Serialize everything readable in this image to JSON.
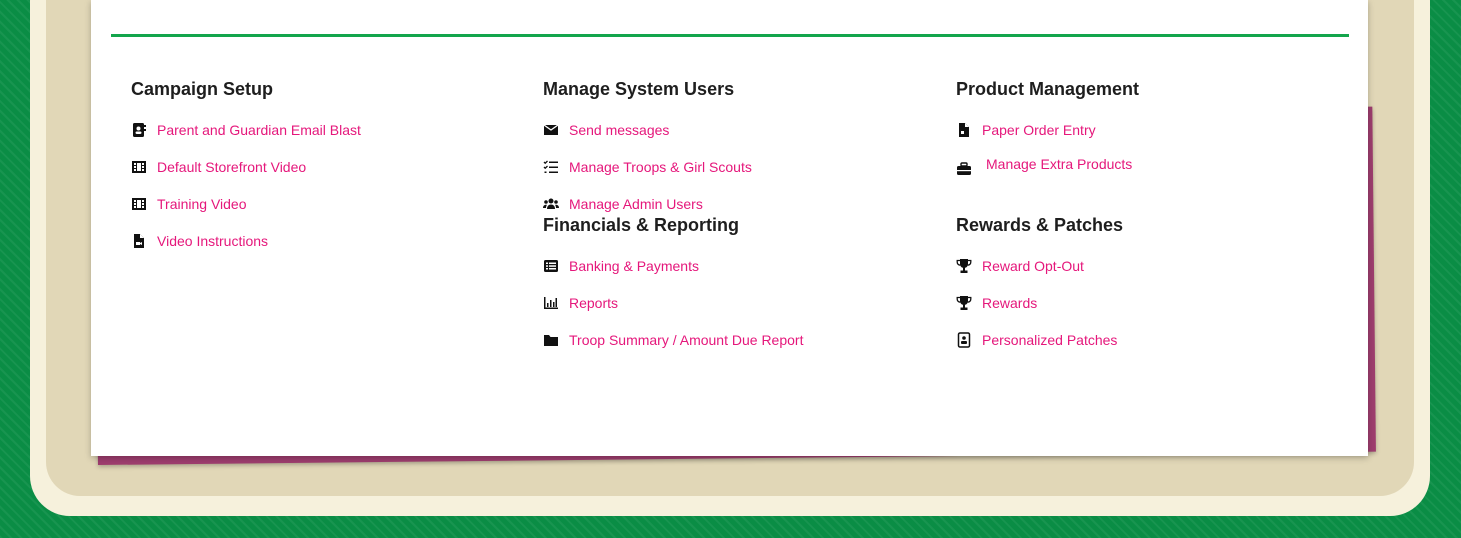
{
  "colors": {
    "accent": "#e5177b",
    "rule": "#13a54c",
    "background": "#0a8d45",
    "sheet": "#9e3d6e"
  },
  "columns": [
    {
      "sections": [
        {
          "title": "Campaign Setup",
          "links": [
            {
              "label": "Parent and Guardian Email Blast",
              "icon": "contact-card-icon"
            },
            {
              "label": "Default Storefront Video",
              "icon": "film-icon"
            },
            {
              "label": "Training Video",
              "icon": "film-icon"
            },
            {
              "label": "Video Instructions",
              "icon": "video-file-icon"
            }
          ]
        }
      ]
    },
    {
      "sections": [
        {
          "title": "Manage System Users",
          "links": [
            {
              "label": "Send messages",
              "icon": "envelope-icon"
            },
            {
              "label": "Manage Troops & Girl Scouts",
              "icon": "checklist-icon"
            },
            {
              "label": "Manage Admin Users",
              "icon": "users-icon"
            }
          ]
        },
        {
          "title": "Financials & Reporting",
          "links": [
            {
              "label": "Banking & Payments",
              "icon": "list-box-icon"
            },
            {
              "label": "Reports",
              "icon": "bar-chart-icon"
            },
            {
              "label": "Troop Summary / Amount Due Report",
              "icon": "folder-icon"
            }
          ]
        }
      ]
    },
    {
      "sections": [
        {
          "title": "Product Management",
          "links": [
            {
              "label": "Paper Order Entry",
              "icon": "file-icon"
            },
            {
              "label": "Manage Extra Products",
              "icon": "briefcase-icon"
            }
          ]
        },
        {
          "title": "Rewards & Patches",
          "links": [
            {
              "label": "Reward Opt-Out",
              "icon": "trophy-icon"
            },
            {
              "label": "Rewards",
              "icon": "trophy-icon"
            },
            {
              "label": "Personalized Patches",
              "icon": "id-badge-icon"
            }
          ]
        }
      ]
    }
  ]
}
